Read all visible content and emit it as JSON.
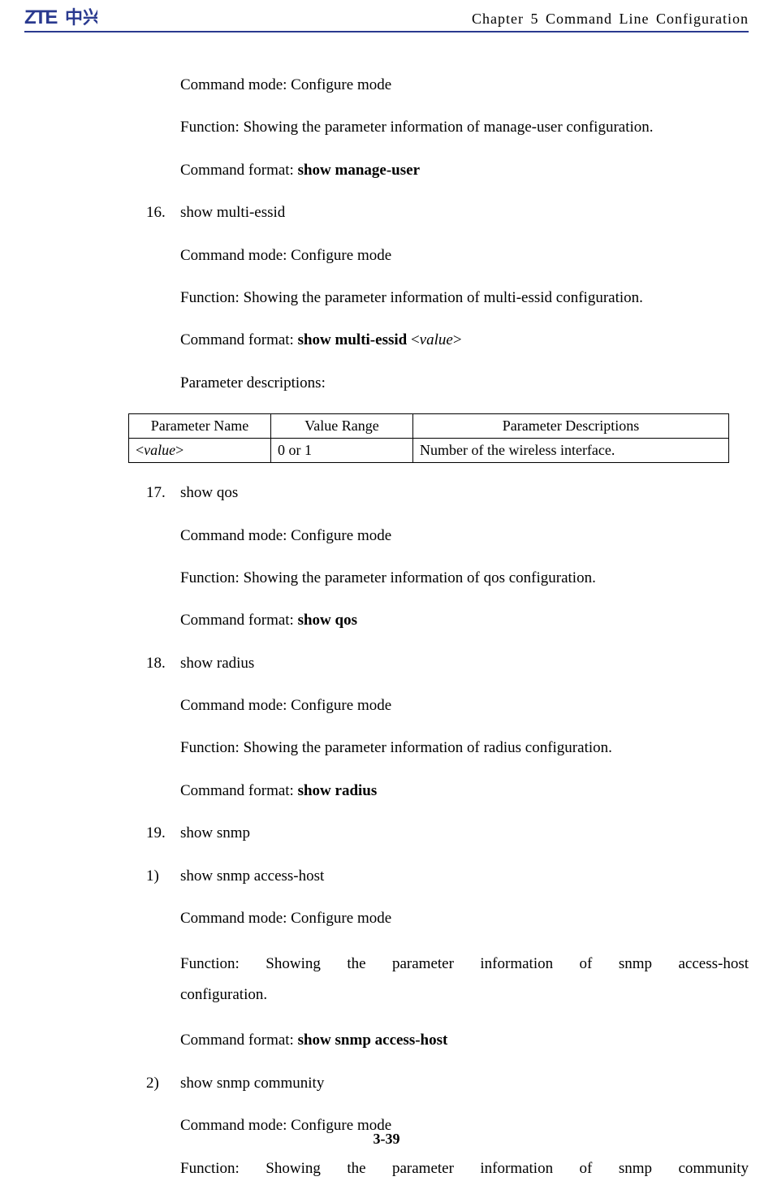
{
  "header": {
    "chapter": "Chapter 5 Command Line Configuration"
  },
  "section_top": {
    "mode": "Command mode: Configure mode",
    "func": "Function: Showing the parameter information of manage-user configuration.",
    "fmt_label": "Command format: ",
    "fmt_cmd": "show manage-user"
  },
  "item16": {
    "num": "16.",
    "title": "show multi-essid",
    "mode": "Command mode: Configure mode",
    "func": "Function: Showing the parameter information of multi-essid configuration.",
    "fmt_label": "Command format: ",
    "fmt_cmd": "show multi-essid ",
    "fmt_arg": "<value>",
    "param_label": "Parameter descriptions:"
  },
  "table16": {
    "h1": "Parameter Name",
    "h2": "Value Range",
    "h3": "Parameter Descriptions",
    "r1c1": "<value>",
    "r1c2": "0 or 1",
    "r1c3": "Number of the wireless interface."
  },
  "item17": {
    "num": "17.",
    "title": "show qos",
    "mode": "Command mode: Configure mode",
    "func": "Function: Showing the parameter information of qos configuration.",
    "fmt_label": "Command format: ",
    "fmt_cmd": "show qos"
  },
  "item18": {
    "num": "18.",
    "title": "show radius",
    "mode": "Command mode: Configure mode",
    "func": "Function: Showing the parameter information of radius configuration.",
    "fmt_label": "Command format: ",
    "fmt_cmd": "show radius"
  },
  "item19": {
    "num": "19.",
    "title": "show snmp"
  },
  "sub1": {
    "num": "1)",
    "title": "show snmp access-host",
    "mode": "Command mode: Configure mode",
    "func_line1": "Function:   Showing   the   parameter   information   of   snmp   access-host",
    "func_line2": "configuration.",
    "fmt_label": "Command format: ",
    "fmt_cmd": "show snmp access-host"
  },
  "sub2": {
    "num": "2)",
    "title": "show snmp community",
    "mode": "Command mode: Configure mode",
    "func_line1": "Function:   Showing   the   parameter   information   of   snmp   community"
  },
  "footer": {
    "page": "3-39"
  }
}
